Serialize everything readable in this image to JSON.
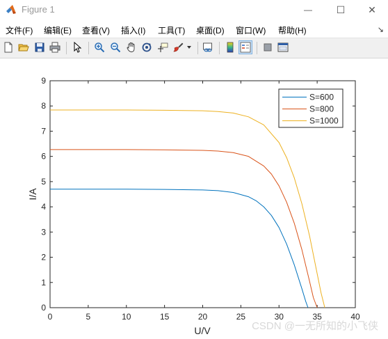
{
  "window": {
    "title": "Figure 1",
    "minimize_glyph": "—",
    "maximize_glyph": "☐",
    "close_glyph": "✕"
  },
  "menu": {
    "items": [
      {
        "label": "文件(F)"
      },
      {
        "label": "编辑(E)"
      },
      {
        "label": "查看(V)"
      },
      {
        "label": "插入(I)"
      },
      {
        "label": "工具(T)"
      },
      {
        "label": "桌面(D)"
      },
      {
        "label": "窗口(W)"
      },
      {
        "label": "帮助(H)"
      }
    ],
    "overflow_glyph": "↘"
  },
  "toolbar": {
    "buttons": [
      {
        "name": "new-figure-icon"
      },
      {
        "name": "open-file-icon"
      },
      {
        "name": "save-icon"
      },
      {
        "name": "print-icon"
      },
      {
        "name": "select-pointer-icon"
      },
      {
        "name": "zoom-in-icon"
      },
      {
        "name": "zoom-out-icon"
      },
      {
        "name": "pan-hand-icon"
      },
      {
        "name": "rotate-3d-icon"
      },
      {
        "name": "data-cursor-icon"
      },
      {
        "name": "brush-icon"
      },
      {
        "name": "link-plot-icon"
      },
      {
        "name": "colorbar-icon"
      },
      {
        "name": "legend-icon"
      },
      {
        "name": "hide-plot-tools-icon"
      },
      {
        "name": "show-plot-tools-icon"
      }
    ]
  },
  "chart_data": {
    "type": "line",
    "xlabel": "U/V",
    "ylabel": "I/A",
    "xlim": [
      0,
      40
    ],
    "ylim": [
      0,
      9
    ],
    "xticks": [
      0,
      5,
      10,
      15,
      20,
      25,
      30,
      35,
      40
    ],
    "yticks": [
      0,
      1,
      2,
      3,
      4,
      5,
      6,
      7,
      8,
      9
    ],
    "grid": false,
    "legend_position": "top-right",
    "series": [
      {
        "name": "S=600",
        "color": "#0072BD",
        "x": [
          0,
          5,
          10,
          15,
          20,
          22,
          24,
          26,
          27,
          28,
          29,
          30,
          31,
          32,
          33,
          33.5,
          33.8
        ],
        "y": [
          4.7,
          4.7,
          4.7,
          4.69,
          4.67,
          4.64,
          4.57,
          4.4,
          4.24,
          4.0,
          3.66,
          3.18,
          2.52,
          1.7,
          0.75,
          0.25,
          0.0
        ]
      },
      {
        "name": "S=800",
        "color": "#D95319",
        "x": [
          0,
          5,
          10,
          15,
          20,
          22,
          24,
          26,
          28,
          29,
          30,
          31,
          32,
          33,
          34,
          34.5,
          35.0
        ],
        "y": [
          6.27,
          6.27,
          6.27,
          6.26,
          6.24,
          6.21,
          6.15,
          6.0,
          5.62,
          5.3,
          4.83,
          4.18,
          3.35,
          2.3,
          1.05,
          0.4,
          0.0
        ]
      },
      {
        "name": "S=1000",
        "color": "#EDB120",
        "x": [
          0,
          5,
          10,
          15,
          20,
          22,
          24,
          26,
          28,
          30,
          31,
          32,
          33,
          34,
          35,
          35.5,
          36.0
        ],
        "y": [
          7.84,
          7.84,
          7.84,
          7.83,
          7.81,
          7.78,
          7.72,
          7.57,
          7.25,
          6.55,
          5.95,
          5.15,
          4.12,
          2.85,
          1.35,
          0.6,
          0.0
        ]
      }
    ]
  },
  "watermark": "CSDN @一无所知的小飞侠"
}
